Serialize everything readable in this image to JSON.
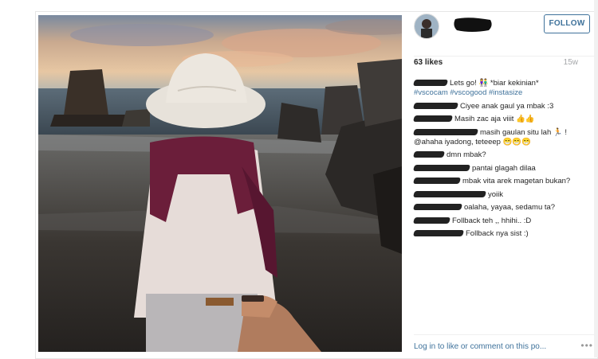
{
  "post": {
    "follow_label": "FOLLOW",
    "likes": "63 likes",
    "age": "15w"
  },
  "comments": [
    {
      "text": "Lets go! 👫 *biar kekinian*",
      "tags": "#vscocam #vscogood #instasize",
      "redact_w": 42
    },
    {
      "text": "Ciyee anak gaul ya mbak :3",
      "redact_w": 55
    },
    {
      "text": "Masih zac aja viiit 👍👍",
      "redact_w": 48
    },
    {
      "text": "masih gaulan situ lah 🏃 ! @ahaha iyadong, teteeep 😁😁😁",
      "redact_w": 80
    },
    {
      "text": "dmn mbak?",
      "redact_w": 38
    },
    {
      "text": "pantai glagah dilaa",
      "redact_w": 70
    },
    {
      "text": "mbak vita arek magetan bukan?",
      "redact_w": 58
    },
    {
      "text": "yoiik",
      "redact_w": 90
    },
    {
      "text": "oalaha, yayaa, sedamu ta?",
      "redact_w": 60
    },
    {
      "text": "Follback teh ,, hhihi.. :D",
      "redact_w": 45
    },
    {
      "text": "Follback nya sist :)",
      "redact_w": 62
    }
  ],
  "footer": {
    "login_text": "Log in to like or comment on this po...",
    "more_icon": "•••"
  },
  "colors": {
    "link": "#3f729b",
    "text": "#262626",
    "muted": "#a5a7aa"
  },
  "icons": {
    "more": "more-options-icon",
    "avatar": "avatar"
  }
}
